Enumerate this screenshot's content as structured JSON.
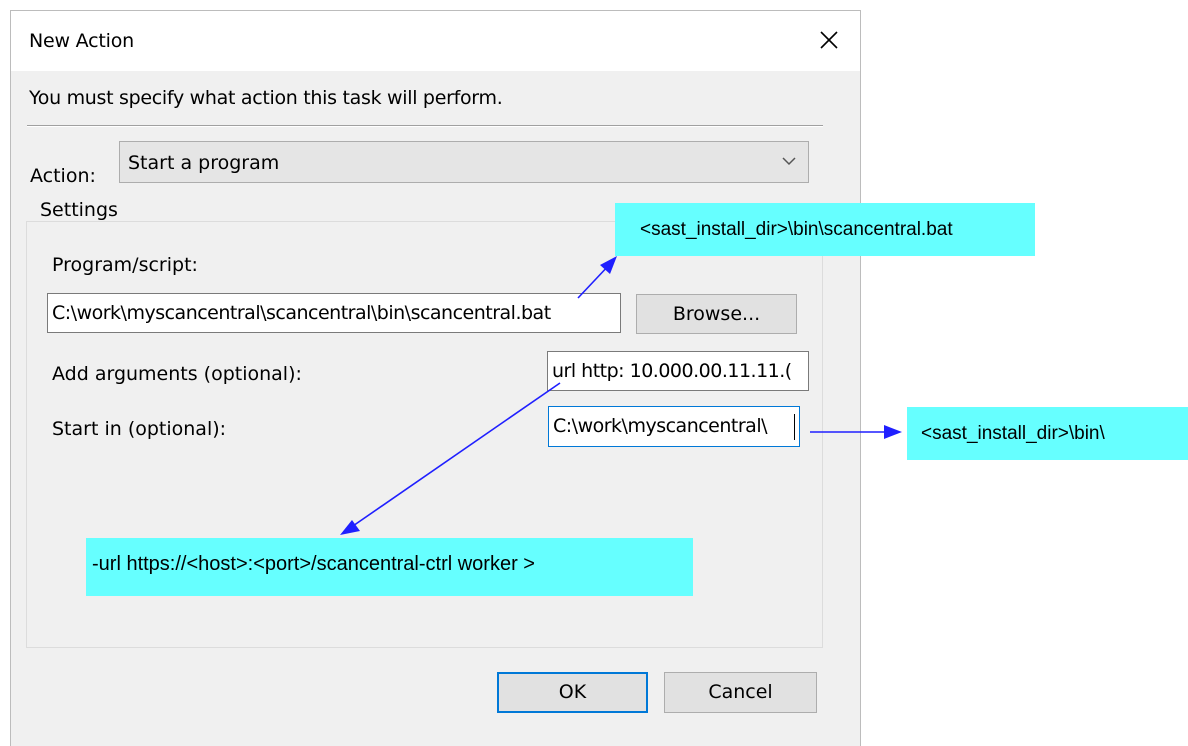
{
  "dialog": {
    "title": "New Action",
    "close_icon": "close-icon",
    "instruction": "You must specify what action this task will perform.",
    "action_label": "Action:",
    "action_value": "Start a program",
    "settings_label": "Settings",
    "program_label": "Program/script:",
    "program_value": "C:\\work\\myscancentral\\scancentral\\bin\\scancentral.bat",
    "browse_label": "Browse...",
    "arguments_label": "Add arguments (optional):",
    "arguments_value": "url http: 10.000.00.11.11.(",
    "startin_label": "Start in (optional):",
    "startin_value": "C:\\work\\myscancentral\\",
    "ok_label": "OK",
    "cancel_label": "Cancel"
  },
  "annotations": {
    "program_note": "<sast_install_dir>\\bin\\scancentral.bat",
    "startin_note": "<sast_install_dir>\\bin\\",
    "arguments_note": "-url https://<host>:<port>/scancentral-ctrl worker >"
  },
  "colors": {
    "callout_fill": "#66ffff",
    "arrow": "#1f1fff",
    "focus_border": "#0078d7",
    "dialog_bg": "#f0f0f0"
  }
}
